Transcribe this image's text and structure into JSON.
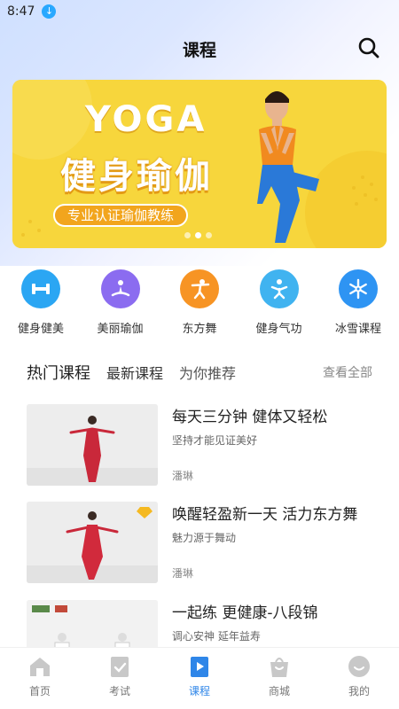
{
  "status_bar": {
    "time": "8:47",
    "download_icon": "download-icon"
  },
  "header": {
    "title": "课程",
    "search_icon": "search-icon"
  },
  "banner": {
    "word": "YOGA",
    "title": "健身瑜伽",
    "subtitle": "专业认证瑜伽教练",
    "slides": 3,
    "active_slide": 1,
    "background_color": "#f7d63c"
  },
  "categories": [
    {
      "label": "健身健美",
      "icon": "dumbbell-icon",
      "color": "#2ba6f3"
    },
    {
      "label": "美丽瑜伽",
      "icon": "meditation-icon",
      "color": "#8b6cf0"
    },
    {
      "label": "东方舞",
      "icon": "dancer-icon",
      "color": "#f79424"
    },
    {
      "label": "健身气功",
      "icon": "qigong-icon",
      "color": "#40b3f0"
    },
    {
      "label": "冰雪课程",
      "icon": "snowflake-icon",
      "color": "#2e94f3"
    }
  ],
  "tabs": {
    "items": [
      "热门课程",
      "最新课程",
      "为你推荐"
    ],
    "active": 0,
    "view_all": "查看全部"
  },
  "courses": [
    {
      "title": "每天三分钟 健体又轻松",
      "subtitle": "坚持才能见证美好",
      "author": "潘琳",
      "vip": false
    },
    {
      "title": "唤醒轻盈新一天 活力东方舞",
      "subtitle": "魅力源于舞动",
      "author": "潘琳",
      "vip": true
    },
    {
      "title": "一起练 更健康-八段锦",
      "subtitle": "调心安神 延年益寿",
      "author": "",
      "vip": false
    }
  ],
  "bottom_nav": {
    "items": [
      {
        "label": "首页",
        "icon": "home-icon"
      },
      {
        "label": "考试",
        "icon": "exam-icon"
      },
      {
        "label": "课程",
        "icon": "course-icon"
      },
      {
        "label": "商城",
        "icon": "shop-icon"
      },
      {
        "label": "我的",
        "icon": "profile-icon"
      }
    ],
    "active": 2,
    "active_color": "#2f86e8"
  }
}
